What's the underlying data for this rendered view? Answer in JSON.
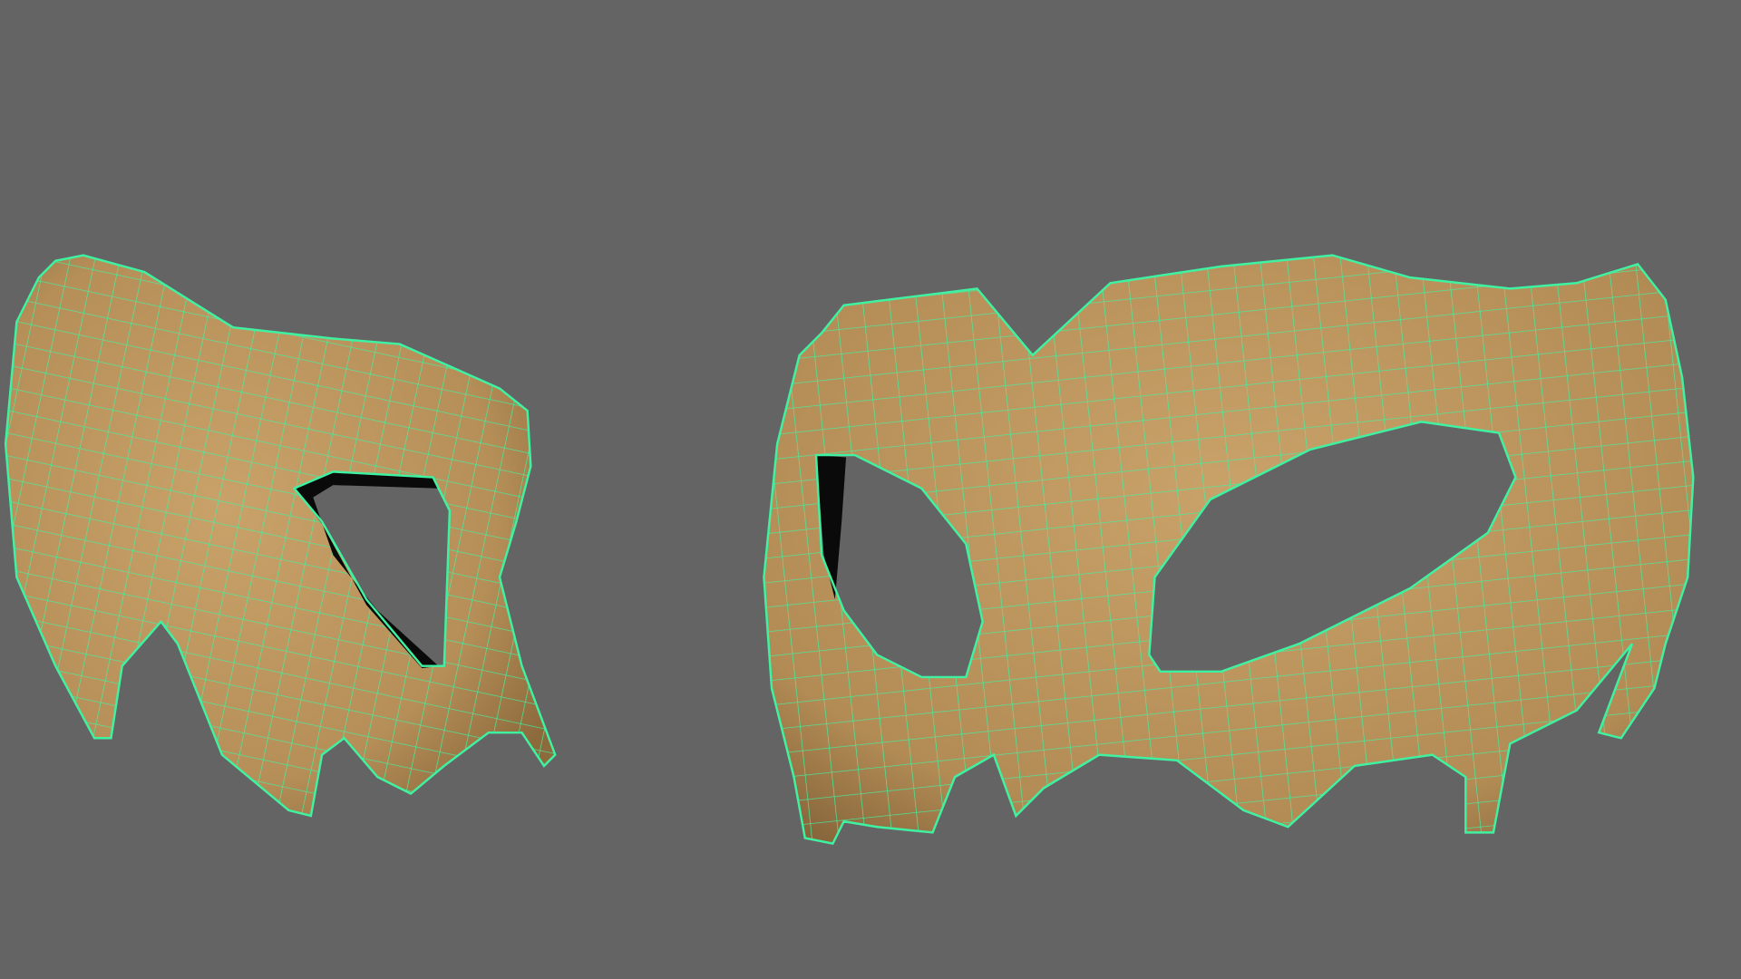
{
  "viewport": {
    "background": "#646464",
    "mesh_fill": "#c29b62",
    "mesh_shadow": "#7a5e35",
    "wire_color": "#3ff2a2",
    "hole_dark": "#0a0a0a"
  }
}
